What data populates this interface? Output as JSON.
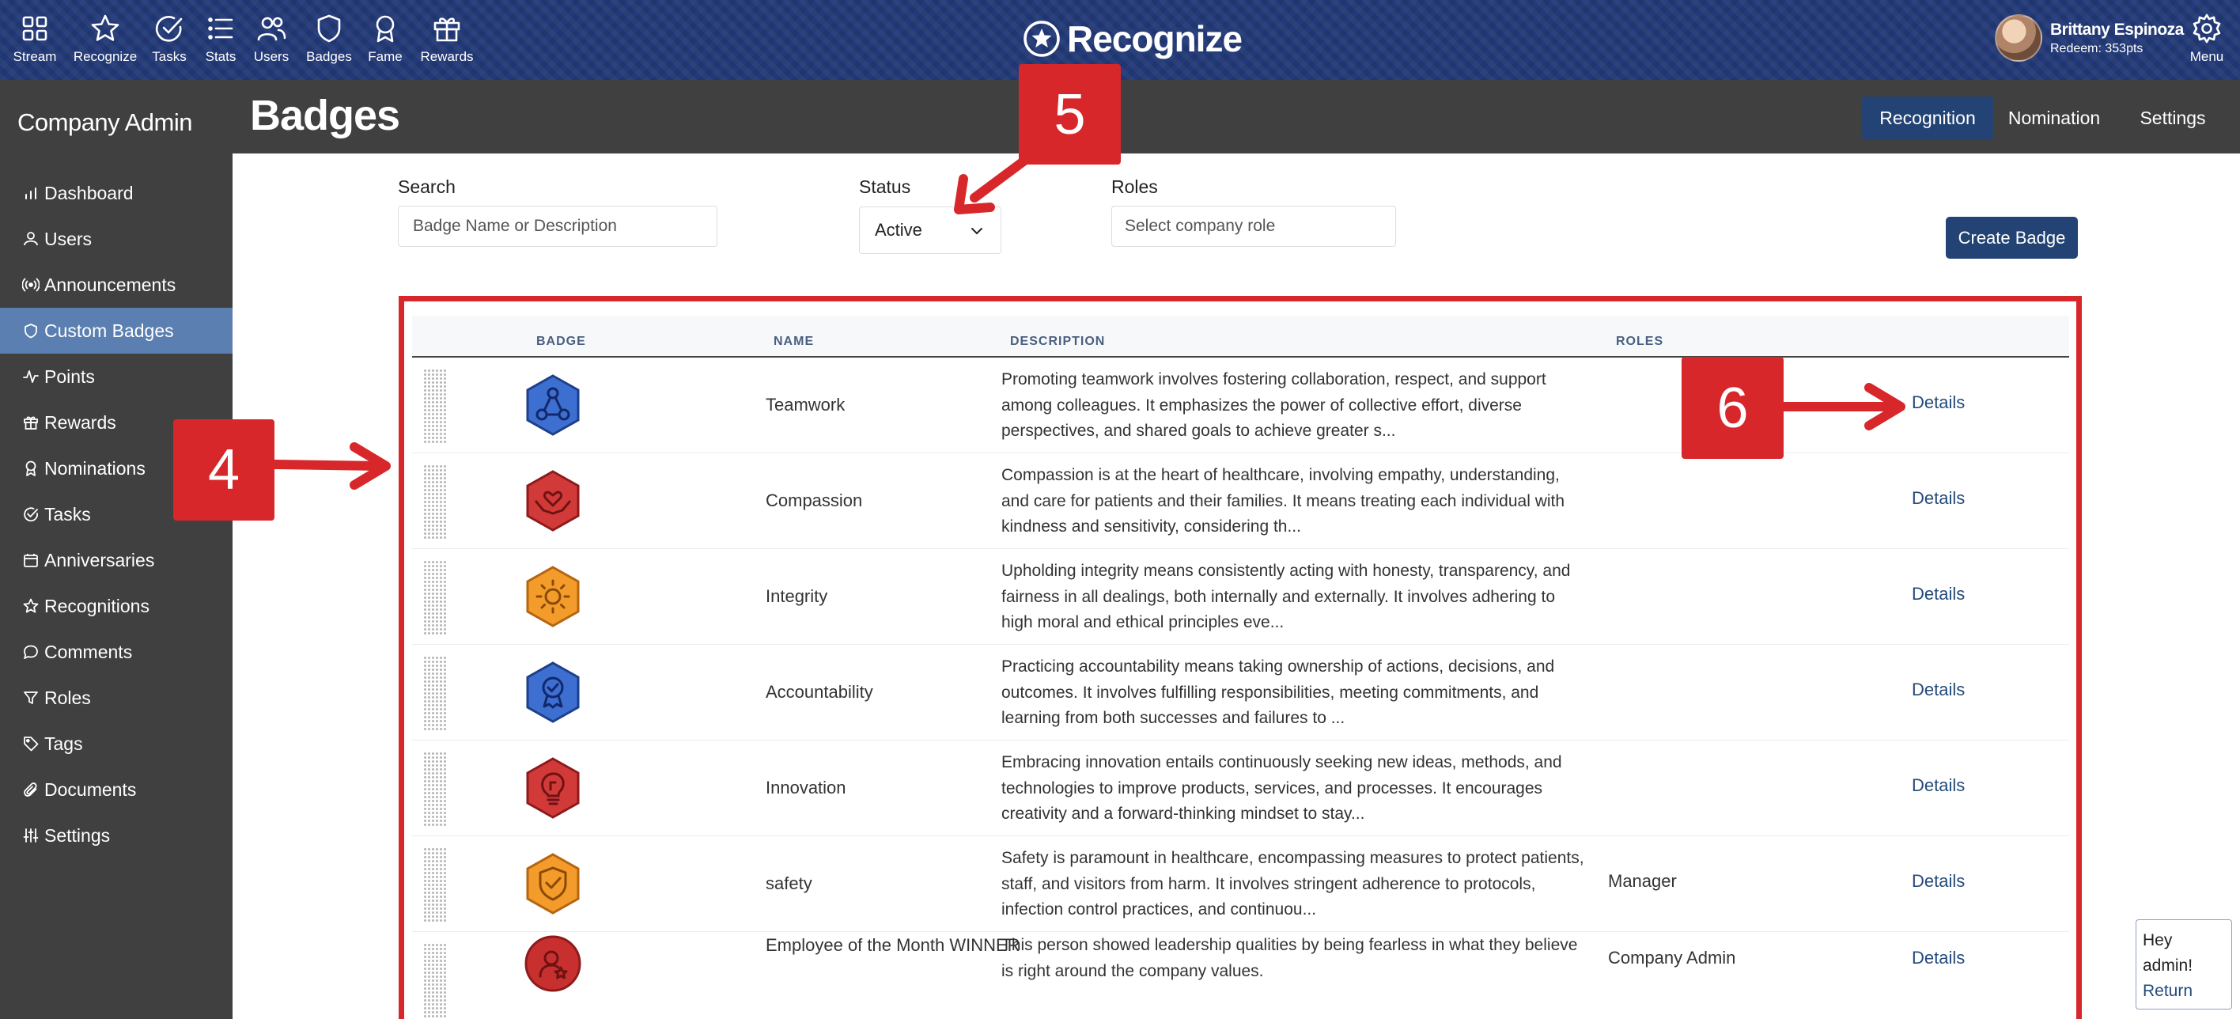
{
  "topnav": {
    "items": [
      {
        "label": "Stream",
        "icon": "grid-icon"
      },
      {
        "label": "Recognize",
        "icon": "star-icon"
      },
      {
        "label": "Tasks",
        "icon": "check-circle-icon"
      },
      {
        "label": "Stats",
        "icon": "list-icon"
      },
      {
        "label": "Users",
        "icon": "users-icon"
      },
      {
        "label": "Badges",
        "icon": "shield-icon"
      },
      {
        "label": "Fame",
        "icon": "award-icon"
      },
      {
        "label": "Rewards",
        "icon": "gift-icon"
      }
    ],
    "brand": "Recognize",
    "user_name": "Brittany Espinoza",
    "user_points": "Redeem: 353pts",
    "menu_label": "Menu"
  },
  "sidebar": {
    "title": "Company Admin",
    "items": [
      {
        "label": "Dashboard",
        "icon": "bar-chart-icon"
      },
      {
        "label": "Users",
        "icon": "user-icon"
      },
      {
        "label": "Announcements",
        "icon": "broadcast-icon"
      },
      {
        "label": "Custom Badges",
        "icon": "shield-icon",
        "active": true
      },
      {
        "label": "Points",
        "icon": "activity-icon"
      },
      {
        "label": "Rewards",
        "icon": "gift-icon"
      },
      {
        "label": "Nominations",
        "icon": "award-icon"
      },
      {
        "label": "Tasks",
        "icon": "check-circle-icon"
      },
      {
        "label": "Anniversaries",
        "icon": "calendar-icon"
      },
      {
        "label": "Recognitions",
        "icon": "star-icon"
      },
      {
        "label": "Comments",
        "icon": "comment-icon"
      },
      {
        "label": "Roles",
        "icon": "filter-icon"
      },
      {
        "label": "Tags",
        "icon": "tag-icon"
      },
      {
        "label": "Documents",
        "icon": "paperclip-icon"
      },
      {
        "label": "Settings",
        "icon": "sliders-icon"
      }
    ]
  },
  "header": {
    "title": "Badges",
    "tabs": [
      {
        "label": "Recognition",
        "active": true
      },
      {
        "label": "Nomination"
      },
      {
        "label": "Settings"
      }
    ]
  },
  "filters": {
    "search_label": "Search",
    "search_placeholder": "Badge Name or Description",
    "status_label": "Status",
    "status_value": "Active",
    "roles_label": "Roles",
    "roles_placeholder": "Select company role",
    "create_button": "Create Badge"
  },
  "table": {
    "columns": [
      "BADGE",
      "NAME",
      "DESCRIPTION",
      "ROLES"
    ],
    "rows": [
      {
        "name": "Teamwork",
        "description": "Promoting teamwork involves fostering collaboration, respect, and support among colleagues. It emphasizes the power of collective effort, diverse perspectives, and shared goals to achieve greater s...",
        "roles": "",
        "action": "Details",
        "color": "#3d6fd1",
        "icon": "teamwork-badge-icon"
      },
      {
        "name": "Compassion",
        "description": "Compassion is at the heart of healthcare, involving empathy, understanding, and care for patients and their families. It means treating each individual with kindness and sensitivity, considering th...",
        "roles": "",
        "action": "Details",
        "color": "#d23a3a",
        "icon": "heart-hands-badge-icon"
      },
      {
        "name": "Integrity",
        "description": "Upholding integrity means consistently acting with honesty, transparency, and fairness in all dealings, both internally and externally. It involves adhering to high moral and ethical principles eve...",
        "roles": "",
        "action": "Details",
        "color": "#f39c2b",
        "icon": "sun-badge-icon"
      },
      {
        "name": "Accountability",
        "description": "Practicing accountability means taking ownership of actions, decisions, and outcomes. It involves fulfilling responsibilities, meeting commitments, and learning from both successes and failures to ...",
        "roles": "",
        "action": "Details",
        "color": "#3d6fd1",
        "icon": "ribbon-badge-icon"
      },
      {
        "name": "Innovation",
        "description": "Embracing innovation entails continuously seeking new ideas, methods, and technologies to improve products, services, and processes. It encourages creativity and a forward-thinking mindset to stay...",
        "roles": "",
        "action": "Details",
        "color": "#d23a3a",
        "icon": "lightbulb-badge-icon"
      },
      {
        "name": "safety",
        "description": "Safety is paramount in healthcare, encompassing measures to protect patients, staff, and visitors from harm. It involves stringent adherence to protocols, infection control practices, and continuou...",
        "roles": "Manager",
        "action": "Details",
        "color": "#f39c2b",
        "icon": "shield-check-badge-icon"
      },
      {
        "name": "Employee of the Month WINNER",
        "description": "This person showed leadership qualities by being fearless in what they believe is right around the company values.",
        "roles": "Company Admin",
        "action": "Details",
        "color": "#c8302f",
        "icon": "person-badge-icon"
      }
    ]
  },
  "annotations": {
    "callout_4": "4",
    "callout_5": "5",
    "callout_6": "6",
    "color": "#d8272b"
  },
  "chat": {
    "line1": "Hey",
    "line2": "admin!",
    "link": "Return"
  }
}
